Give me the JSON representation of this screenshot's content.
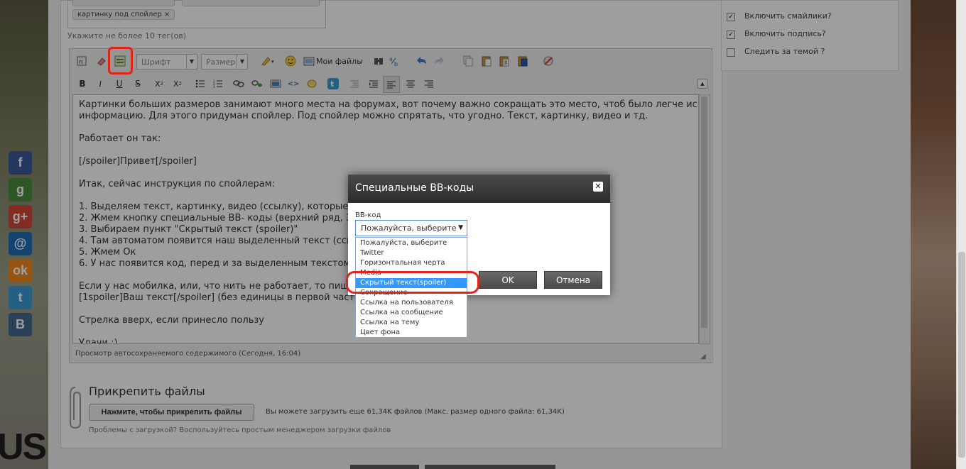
{
  "tags": [
    "картинку под спойлер"
  ],
  "tags_hint": "Укажите не более 10 тег(ов)",
  "toolbar": {
    "font_label": "Шрифт",
    "size_label": "Размер",
    "my_files_label": "Мои файлы"
  },
  "editor_lines": [
    "Картинки больших размеров занимают много места на форумах, вот почему важно сокращать это место, чтоб было легче искать",
    "информацию. Для этого придуман спойлер. Под спойлер можно спрятать, что угодно. Текст, картинку, видео и тд.",
    "",
    "Работает он так:",
    "",
    "[/spoiler]Привет[/spoiler]",
    "",
    "Итак, сейчас инструкция по спойлерам:",
    "",
    "1. Выделяем текст, картинку, видео (ссылку), которые хот",
    "2. Жмем кнопку специальные ВВ- коды (верхний ряд, 3 сл",
    "3. Выбираем пункт \"Скрытый текст (spoiler)\"",
    "4. Там автоматом появится наш выделенный текст (ссыл",
    "5. Жмем Ок",
    "6. У нас появится код, перед и за выделенным текстом. З",
    "",
    "Если у нас мобилка, или, что нить не работает, то пише",
    "[1spoiler]Ваш текст[/spoiler]  (без единицы в первой части к",
    "",
    "Стрелка вверх, если принесло пользу",
    "",
    "Удачи :)"
  ],
  "autosave_text": "Просмотр автосохраняемого содержимого (Сегодня, 16:04)",
  "side_options": [
    {
      "label": "Включить смайлики?",
      "checked": true
    },
    {
      "label": "Включить подпись?",
      "checked": true
    },
    {
      "label": "Следить за темой ?",
      "checked": false
    }
  ],
  "attach": {
    "title": "Прикрепить файлы",
    "button": "Нажмите, чтобы прикрепить файлы",
    "info": "Вы можете загрузить еще 61,34K файлов (Макс. размер одного файла: 61,34K)",
    "note": "Проблемы с загрузкой? Воспользуйтесь простым менеджером загрузки файлов"
  },
  "dialog": {
    "title": "Специальные ВВ-коды",
    "field_label": "ВВ-код",
    "select_value": "Пожалуйста, выберите",
    "options": [
      "Пожалуйста, выберите",
      "Twitter",
      "Горизонтальная черта",
      "Media",
      "Скрытый текст(spoiler)",
      "Сокращение",
      "Ссылка на пользователя",
      "Ссылка на сообщение",
      "Ссылка на тему",
      "Цвет фона"
    ],
    "selected_index": 4,
    "ok": "OK",
    "cancel": "Отмена"
  },
  "social": [
    {
      "name": "facebook-icon",
      "glyph": "f",
      "color": "#3b5998"
    },
    {
      "name": "google-icon",
      "glyph": "g",
      "color": "#4a8d3a"
    },
    {
      "name": "google-plus-icon",
      "glyph": "g+",
      "color": "#d34836"
    },
    {
      "name": "mail-icon",
      "glyph": "@",
      "color": "#1f6fb6"
    },
    {
      "name": "odnoklassniki-icon",
      "glyph": "ok",
      "color": "#f2891f"
    },
    {
      "name": "twitter-icon",
      "glyph": "t",
      "color": "#3b9ad9"
    },
    {
      "name": "vkontakte-icon",
      "glyph": "B",
      "color": "#466a8f"
    }
  ],
  "brand_text": "US",
  "colors": {
    "highlight": "#e2231a",
    "selected": "#3399ff",
    "dialog_header": "#2c2c2c"
  }
}
